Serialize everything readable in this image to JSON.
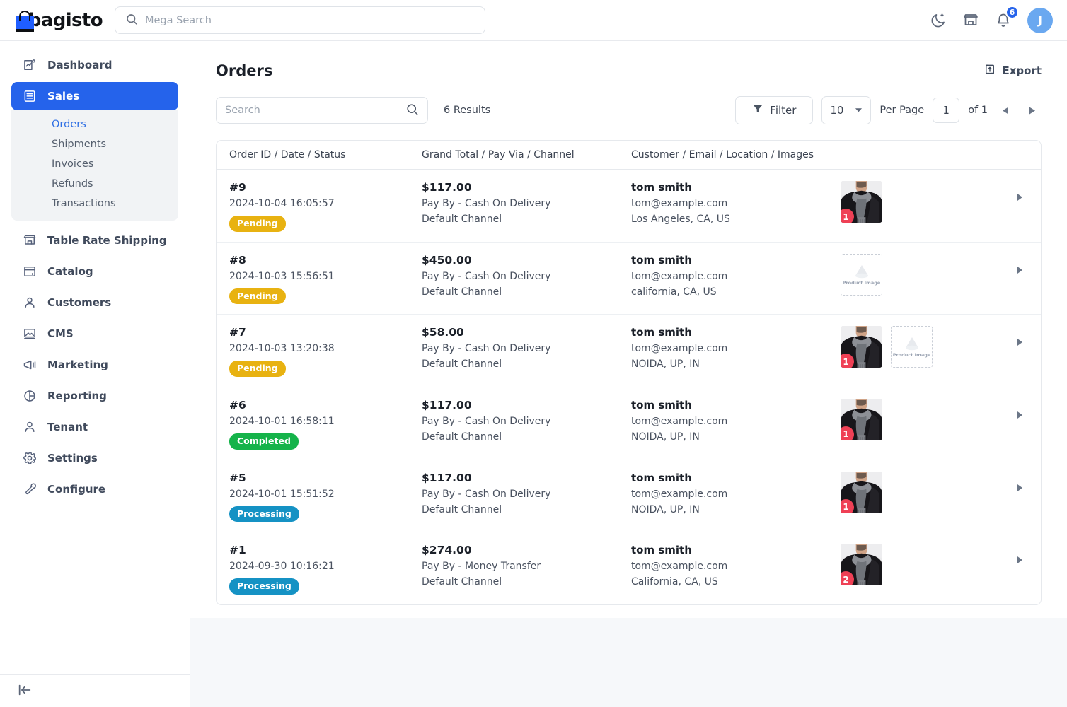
{
  "topbar": {
    "brand_name": "bagisto",
    "mega_search_placeholder": "Mega Search",
    "mega_search_value": "",
    "dark_mode_icon": "moon-icon",
    "store_icon": "store-icon",
    "notifications_icon": "bell-icon",
    "notifications_count": "6",
    "avatar_initial": "J"
  },
  "sidebar": {
    "items": [
      {
        "label": "Dashboard",
        "icon": "dashboard-icon",
        "active": false
      },
      {
        "label": "Sales",
        "icon": "sales-icon",
        "active": true
      },
      {
        "label": "Table Rate Shipping",
        "icon": "store-icon",
        "active": false
      },
      {
        "label": "Catalog",
        "icon": "catalog-icon",
        "active": false
      },
      {
        "label": "Customers",
        "icon": "user-icon",
        "active": false
      },
      {
        "label": "CMS",
        "icon": "image-icon",
        "active": false
      },
      {
        "label": "Marketing",
        "icon": "megaphone-icon",
        "active": false
      },
      {
        "label": "Reporting",
        "icon": "pie-chart-icon",
        "active": false
      },
      {
        "label": "Tenant",
        "icon": "user-icon",
        "active": false
      },
      {
        "label": "Settings",
        "icon": "gear-icon",
        "active": false
      },
      {
        "label": "Configure",
        "icon": "wrench-icon",
        "active": false
      }
    ],
    "submenu": [
      {
        "label": "Orders",
        "current": true
      },
      {
        "label": "Shipments",
        "current": false
      },
      {
        "label": "Invoices",
        "current": false
      },
      {
        "label": "Refunds",
        "current": false
      },
      {
        "label": "Transactions",
        "current": false
      }
    ],
    "collapse_icon": "collapse-sidebar-icon"
  },
  "page": {
    "title": "Orders",
    "export_label": "Export",
    "export_icon": "export-icon"
  },
  "toolbar": {
    "search_placeholder": "Search",
    "search_value": "",
    "search_icon": "search-icon",
    "results_text": "6 Results",
    "filter_label": "Filter",
    "filter_icon": "funnel-icon",
    "per_page_value": "10",
    "per_page_label": "Per Page",
    "page_value": "1",
    "of_label": "of 1",
    "prev_icon": "chevron-left-icon",
    "next_icon": "chevron-right-icon"
  },
  "table": {
    "columns": [
      "Order ID / Date / Status",
      "Grand Total / Pay Via / Channel",
      "Customer / Email / Location / Images"
    ],
    "rows": [
      {
        "order_id": "#9",
        "date": "2024-10-04 16:05:57",
        "status": "Pending",
        "status_type": "pending",
        "grand_total": "$117.00",
        "pay_via": "Pay By - Cash On Delivery",
        "channel": "Default Channel",
        "customer": "tom smith",
        "email": "tom@example.com",
        "location": "Los Angeles, CA, US",
        "images": [
          {
            "type": "photo",
            "qty": "1"
          }
        ]
      },
      {
        "order_id": "#8",
        "date": "2024-10-03 15:56:51",
        "status": "Pending",
        "status_type": "pending",
        "grand_total": "$450.00",
        "pay_via": "Pay By - Cash On Delivery",
        "channel": "Default Channel",
        "customer": "tom smith",
        "email": "tom@example.com",
        "location": "california, CA, US",
        "images": [
          {
            "type": "placeholder",
            "label": "Product Image"
          }
        ]
      },
      {
        "order_id": "#7",
        "date": "2024-10-03 13:20:38",
        "status": "Pending",
        "status_type": "pending",
        "grand_total": "$58.00",
        "pay_via": "Pay By - Cash On Delivery",
        "channel": "Default Channel",
        "customer": "tom smith",
        "email": "tom@example.com",
        "location": "NOIDA, UP, IN",
        "images": [
          {
            "type": "photo",
            "qty": "1"
          },
          {
            "type": "placeholder",
            "label": "Product Image"
          }
        ]
      },
      {
        "order_id": "#6",
        "date": "2024-10-01 16:58:11",
        "status": "Completed",
        "status_type": "completed",
        "grand_total": "$117.00",
        "pay_via": "Pay By - Cash On Delivery",
        "channel": "Default Channel",
        "customer": "tom smith",
        "email": "tom@example.com",
        "location": "NOIDA, UP, IN",
        "images": [
          {
            "type": "photo",
            "qty": "1"
          }
        ]
      },
      {
        "order_id": "#5",
        "date": "2024-10-01 15:51:52",
        "status": "Processing",
        "status_type": "processing",
        "grand_total": "$117.00",
        "pay_via": "Pay By - Cash On Delivery",
        "channel": "Default Channel",
        "customer": "tom smith",
        "email": "tom@example.com",
        "location": "NOIDA, UP, IN",
        "images": [
          {
            "type": "photo",
            "qty": "1"
          }
        ]
      },
      {
        "order_id": "#1",
        "date": "2024-09-30 10:16:21",
        "status": "Processing",
        "status_type": "processing",
        "grand_total": "$274.00",
        "pay_via": "Pay By - Money Transfer",
        "channel": "Default Channel",
        "customer": "tom smith",
        "email": "tom@example.com",
        "location": "California, CA, US",
        "images": [
          {
            "type": "photo",
            "qty": "2"
          }
        ]
      }
    ]
  },
  "colors": {
    "accent": "#2563eb",
    "pending": "#e8b211",
    "completed": "#15b34a",
    "processing": "#1592c4",
    "qty_badge": "#ef4055"
  }
}
